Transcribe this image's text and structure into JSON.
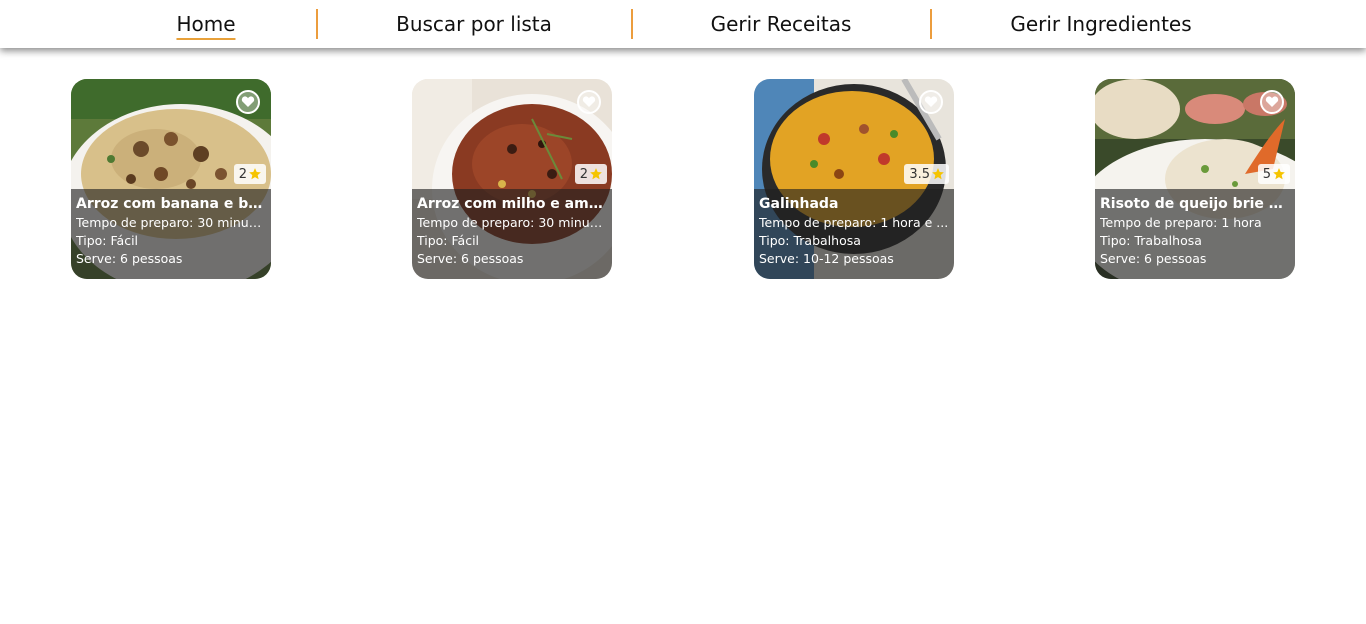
{
  "nav": {
    "items": [
      {
        "label": "Home",
        "active": true
      },
      {
        "label": "Buscar por lista",
        "active": false
      },
      {
        "label": "Gerir Receitas",
        "active": false
      },
      {
        "label": "Gerir Ingredientes",
        "active": false
      }
    ],
    "accent_color": "#ec9d3d"
  },
  "recipes": [
    {
      "title": "Arroz com banana e ba...",
      "prep": "Tempo de preparo: 30 minutos",
      "type": "Tipo: Fácil",
      "serves": "Serve: 6 pessoas",
      "rating": "2",
      "favorite_icon": "heart-icon",
      "image": "rice-with-banana-photo"
    },
    {
      "title": "Arroz com milho e amei...",
      "prep": "Tempo de preparo: 30 minutos",
      "type": "Tipo: Fácil",
      "serves": "Serve: 6 pessoas",
      "rating": "2",
      "favorite_icon": "heart-icon",
      "image": "rice-with-corn-photo"
    },
    {
      "title": "Galinhada",
      "prep": "Tempo de preparo: 1 hora e ...",
      "type": "Tipo: Trabalhosa",
      "serves": "Serve: 10-12 pessoas",
      "rating": "3.5",
      "favorite_icon": "heart-icon",
      "image": "galinhada-photo"
    },
    {
      "title": "Risoto de queijo brie co...",
      "prep": "Tempo de preparo: 1 hora",
      "type": "Tipo: Trabalhosa",
      "serves": "Serve: 6 pessoas",
      "rating": "5",
      "favorite_icon": "heart-icon",
      "image": "brie-risotto-photo"
    }
  ],
  "star_color": "#f5c400"
}
